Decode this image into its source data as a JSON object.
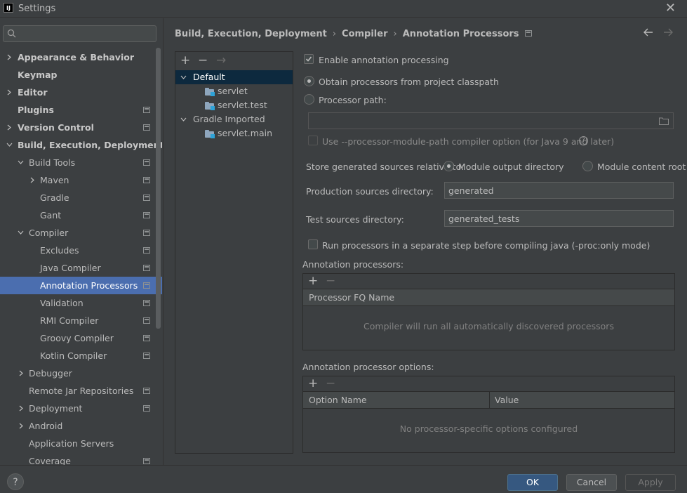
{
  "window": {
    "title": "Settings",
    "app_icon": "IJ"
  },
  "search": {
    "placeholder": ""
  },
  "sidebar": {
    "items": [
      {
        "label": "Appearance & Behavior"
      },
      {
        "label": "Keymap"
      },
      {
        "label": "Editor"
      },
      {
        "label": "Plugins"
      },
      {
        "label": "Version Control"
      },
      {
        "label": "Build, Execution, Deployment"
      },
      {
        "label": "Build Tools"
      },
      {
        "label": "Maven"
      },
      {
        "label": "Gradle"
      },
      {
        "label": "Gant"
      },
      {
        "label": "Compiler"
      },
      {
        "label": "Excludes"
      },
      {
        "label": "Java Compiler"
      },
      {
        "label": "Annotation Processors"
      },
      {
        "label": "Validation"
      },
      {
        "label": "RMI Compiler"
      },
      {
        "label": "Groovy Compiler"
      },
      {
        "label": "Kotlin Compiler"
      },
      {
        "label": "Debugger"
      },
      {
        "label": "Remote Jar Repositories"
      },
      {
        "label": "Deployment"
      },
      {
        "label": "Android"
      },
      {
        "label": "Application Servers"
      },
      {
        "label": "Coverage"
      }
    ]
  },
  "breadcrumb": {
    "items": [
      "Build, Execution, Deployment",
      "Compiler",
      "Annotation Processors"
    ],
    "separator": "›"
  },
  "modules": {
    "toolbar": {
      "add": "+",
      "remove": "−",
      "move": "→"
    },
    "items": [
      {
        "label": "Default"
      },
      {
        "label": "servlet"
      },
      {
        "label": "servlet.test"
      },
      {
        "label": "Gradle Imported"
      },
      {
        "label": "servlet.main"
      }
    ]
  },
  "settings": {
    "enable_processing": {
      "label": "Enable annotation processing",
      "checked": true
    },
    "obtain_from_classpath": {
      "label": "Obtain processors from project classpath",
      "checked": true
    },
    "processor_path": {
      "label": "Processor path:",
      "value": ""
    },
    "module_path_option": {
      "label": "Use --processor-module-path compiler option (for Java 9 and later)",
      "checked": false
    },
    "store_relative": {
      "label": "Store generated sources relative to:",
      "option_output": "Module output directory",
      "option_content": "Module content root",
      "selected": "Module output directory"
    },
    "production_dir": {
      "label": "Production sources directory:",
      "value": "generated"
    },
    "test_dir": {
      "label": "Test sources directory:",
      "value": "generated_tests"
    },
    "separate_step": {
      "label": "Run processors in a separate step before compiling java (-proc:only mode)",
      "checked": false
    }
  },
  "processors_table": {
    "title": "Annotation processors:",
    "toolbar": {
      "add": "+",
      "remove": "−"
    },
    "column": "Processor FQ Name",
    "empty": "Compiler will run all automatically discovered processors"
  },
  "options_table": {
    "title": "Annotation processor options:",
    "toolbar": {
      "add": "+",
      "remove": "−"
    },
    "columns": [
      "Option Name",
      "Value"
    ],
    "empty": "No processor-specific options configured"
  },
  "footer": {
    "help": "?",
    "ok": "OK",
    "cancel": "Cancel",
    "apply": "Apply"
  },
  "colors": {
    "background": "#3c3f41",
    "selection": "#4b6eaf",
    "primary_button": "#365880",
    "module_selection": "#0d293e"
  }
}
